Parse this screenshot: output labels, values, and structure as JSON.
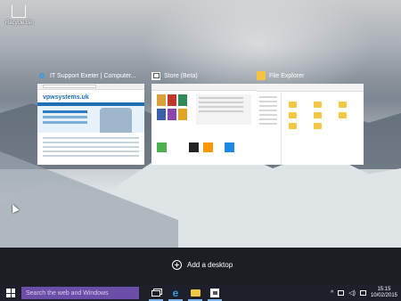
{
  "desktop": {
    "recycle_bin_label": "Recycle Bin"
  },
  "windows": [
    {
      "title": "IT Support Exeter | Computer...",
      "icon": "internet-explorer-icon"
    },
    {
      "title": "Store (Beta)",
      "icon": "store-icon"
    },
    {
      "title": "File Explorer",
      "icon": "file-explorer-icon"
    }
  ],
  "ie_page": {
    "logo_text": "vpwsystems.uk"
  },
  "task_view": {
    "add_desktop_label": "Add a desktop"
  },
  "taskbar": {
    "search_placeholder": "Search the web and Windows",
    "clock_time": "15:15",
    "clock_date": "10/02/2015",
    "search_color": "#6b4ea8"
  }
}
